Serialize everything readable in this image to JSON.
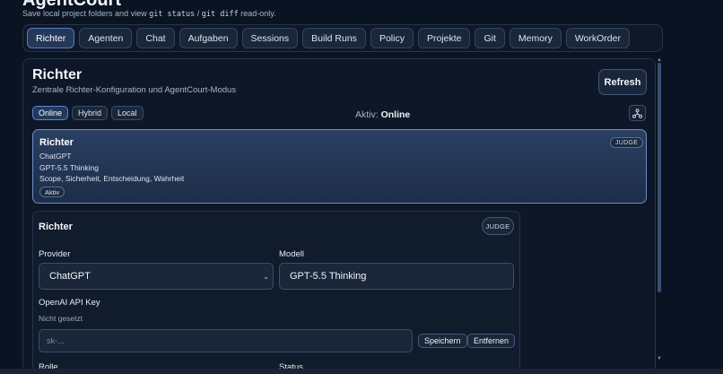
{
  "app": {
    "title": "AgentCourt",
    "subtitle_pre": "Save local project folders and view ",
    "subtitle_code1": "git status",
    "subtitle_sep": " / ",
    "subtitle_code2": "git diff",
    "subtitle_post": " read-only."
  },
  "tabs": [
    {
      "label": "Richter",
      "active": true
    },
    {
      "label": "Agenten"
    },
    {
      "label": "Chat"
    },
    {
      "label": "Aufgaben"
    },
    {
      "label": "Sessions"
    },
    {
      "label": "Build Runs"
    },
    {
      "label": "Policy"
    },
    {
      "label": "Projekte"
    },
    {
      "label": "Git"
    },
    {
      "label": "Memory"
    },
    {
      "label": "WorkOrder"
    }
  ],
  "section": {
    "title": "Richter",
    "subtitle": "Zentrale Richter-Konfiguration und AgentCourt-Modus",
    "refresh_label": "Refresh",
    "modes": [
      {
        "label": "Online",
        "active": true
      },
      {
        "label": "Hybrid"
      },
      {
        "label": "Local"
      }
    ],
    "aktiv_label": "Aktiv:",
    "aktiv_value": "Online",
    "network_icon": "network-icon"
  },
  "judge_card": {
    "name": "Richter",
    "provider": "ChatGPT",
    "model": "GPT-5.5 Thinking",
    "scope": "Scope, Sicherheit, Entscheidung, Wahrheit",
    "badge": "JUDGE",
    "status": "Aktiv"
  },
  "editor": {
    "title": "Richter",
    "badge": "JUDGE",
    "provider_label": "Provider",
    "provider_value": "ChatGPT",
    "model_label": "Modell",
    "model_value": "GPT-5.5 Thinking",
    "api_key_label": "OpenAI API Key",
    "api_key_status": "Nicht gesetzt",
    "api_key_placeholder": "sk-...",
    "save_label": "Speichern",
    "remove_label": "Entfernen",
    "next_label_left": "Rolle",
    "next_label_right": "Status"
  }
}
